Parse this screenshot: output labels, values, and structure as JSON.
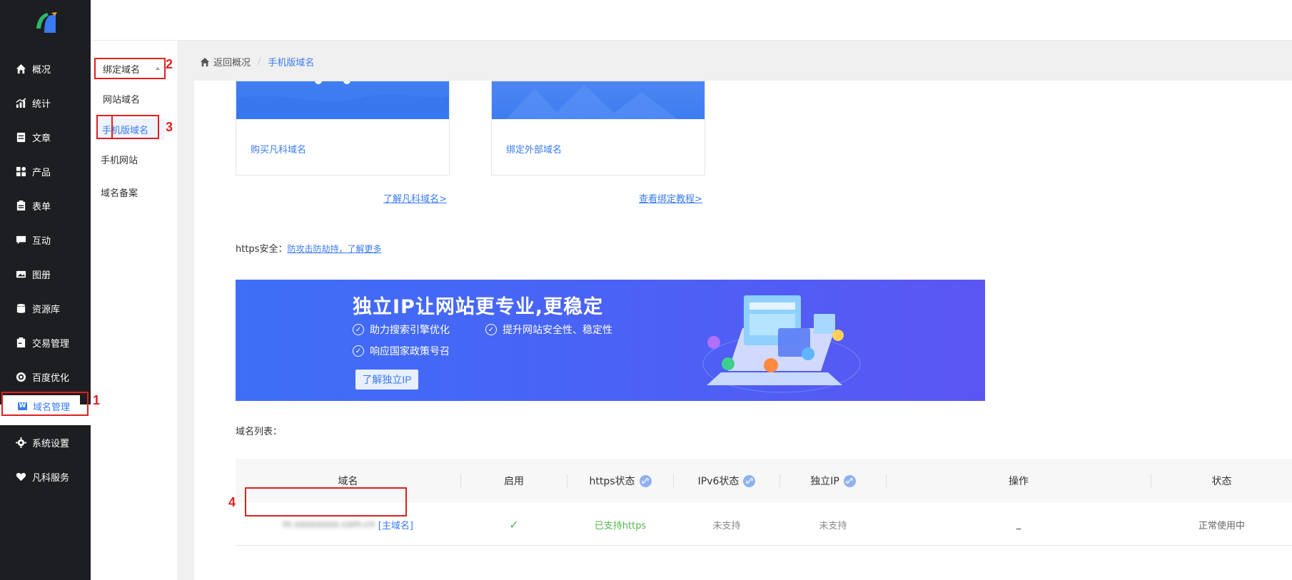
{
  "sidebar": {
    "items": [
      {
        "label": "概况",
        "icon": "home-icon"
      },
      {
        "label": "统计",
        "icon": "stats-icon"
      },
      {
        "label": "文章",
        "icon": "article-icon"
      },
      {
        "label": "产品",
        "icon": "product-icon"
      },
      {
        "label": "表单",
        "icon": "form-icon"
      },
      {
        "label": "互动",
        "icon": "chat-icon"
      },
      {
        "label": "图册",
        "icon": "gallery-icon"
      },
      {
        "label": "资源库",
        "icon": "database-icon"
      },
      {
        "label": "交易管理",
        "icon": "clipboard-icon"
      },
      {
        "label": "百度优化",
        "icon": "target-icon"
      },
      {
        "label": "域名管理",
        "icon": "domain-w-icon"
      },
      {
        "label": "系统设置",
        "icon": "gear-icon"
      },
      {
        "label": "凡科服务",
        "icon": "heart-icon"
      }
    ]
  },
  "subnav": {
    "group": "绑定域名",
    "items": [
      "网站域名",
      "手机版域名",
      "手机网站",
      "域名备案"
    ]
  },
  "breadcrumb": {
    "back": "返回概况",
    "separator": "/",
    "current": "手机版域名"
  },
  "cards": [
    {
      "title": "购买凡科域名",
      "link": "了解凡科域名>"
    },
    {
      "title": "绑定外部域名",
      "link": "查看绑定教程>"
    }
  ],
  "https": {
    "label": "https安全：",
    "link": "防攻击防劫持，了解更多"
  },
  "banner": {
    "title": "独立IP让网站更专业,更稳定",
    "features": [
      "助力搜索引擎优化",
      "提升网站安全性、稳定性",
      "响应国家政策号召"
    ],
    "button": "了解独立IP"
  },
  "domain_list": {
    "label": "域名列表：",
    "headers": [
      "域名",
      "启用",
      "https状态",
      "IPv6状态",
      "独立IP",
      "操作",
      "状态"
    ],
    "rows": [
      {
        "domain": "m.xxxxxxxx.com.cn",
        "tag": "[主域名]",
        "enabled": "✓",
        "https": "已支持https",
        "ipv6": "未支持",
        "ip": "未支持",
        "action": "_",
        "status": "正常使用中"
      }
    ]
  },
  "annotations": [
    "1",
    "2",
    "3",
    "4"
  ],
  "colors": {
    "accent": "#3a7af2",
    "sidebar_bg": "#1d1e21",
    "annotation_red": "#e02020",
    "success_green": "#52b84a"
  }
}
